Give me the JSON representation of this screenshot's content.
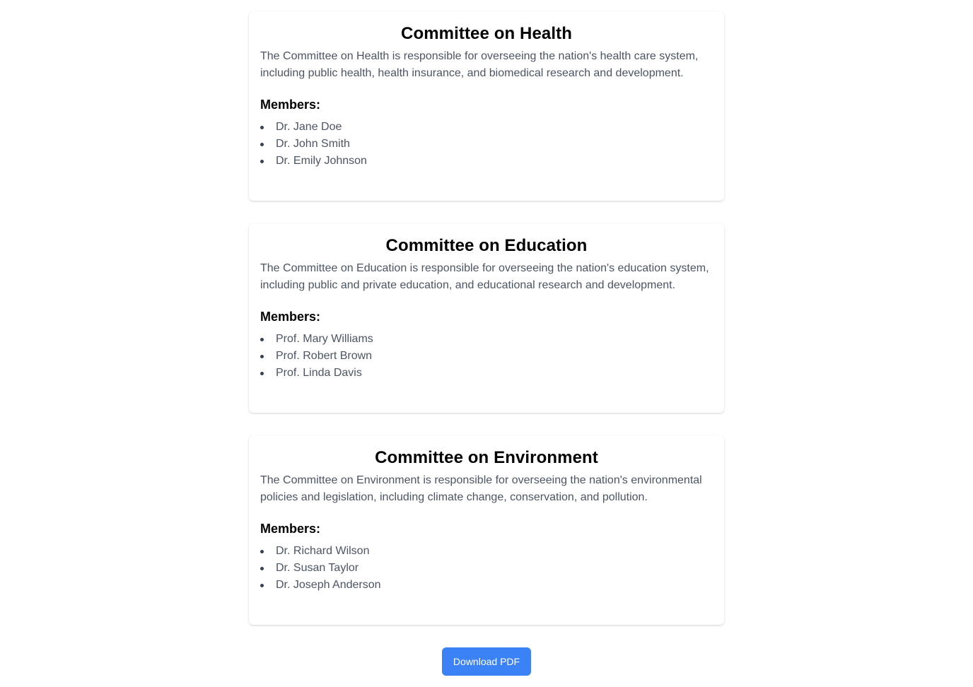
{
  "committees": [
    {
      "title": "Committee on Health",
      "description": "The Committee on Health is responsible for overseeing the nation's health care system, including public health, health insurance, and biomedical research and development.",
      "members_heading": "Members:",
      "members": [
        "Dr. Jane Doe",
        "Dr. John Smith",
        "Dr. Emily Johnson"
      ]
    },
    {
      "title": "Committee on Education",
      "description": "The Committee on Education is responsible for overseeing the nation's education system, including public and private education, and educational research and development.",
      "members_heading": "Members:",
      "members": [
        "Prof. Mary Williams",
        "Prof. Robert Brown",
        "Prof. Linda Davis"
      ]
    },
    {
      "title": "Committee on Environment",
      "description": "The Committee on Environment is responsible for overseeing the nation's environmental policies and legislation, including climate change, conservation, and pollution.",
      "members_heading": "Members:",
      "members": [
        "Dr. Richard Wilson",
        "Dr. Susan Taylor",
        "Dr. Joseph Anderson"
      ]
    }
  ],
  "actions": {
    "download_label": "Download PDF"
  },
  "colors": {
    "button_bg": "#3b82f6",
    "body_text": "#4b5563",
    "heading_text": "#000000"
  }
}
